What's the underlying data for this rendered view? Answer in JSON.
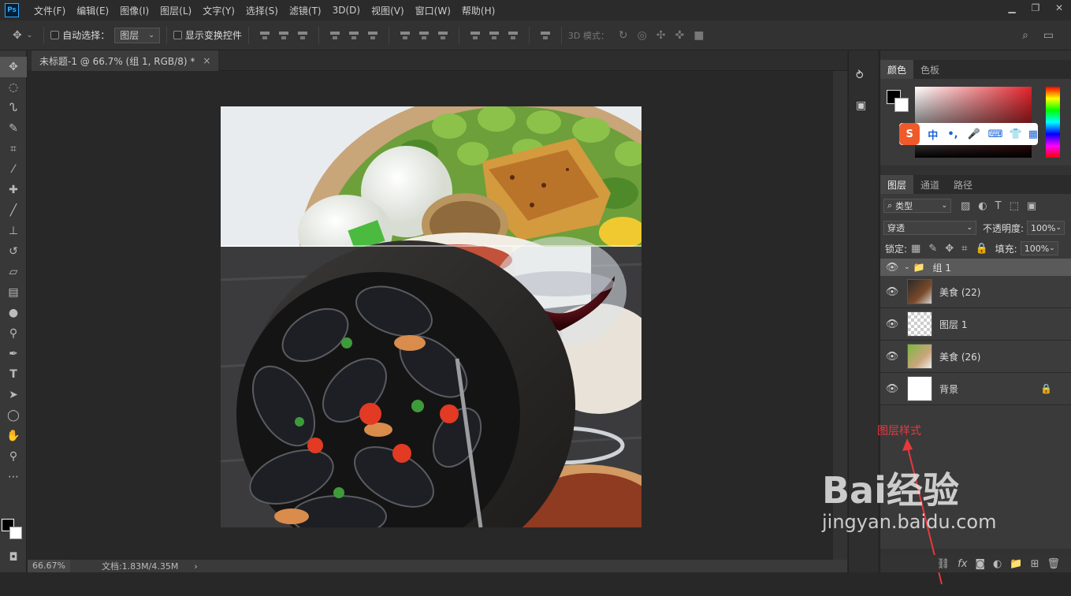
{
  "menu": [
    "文件(F)",
    "编辑(E)",
    "图像(I)",
    "图层(L)",
    "文字(Y)",
    "选择(S)",
    "滤镜(T)",
    "3D(D)",
    "视图(V)",
    "窗口(W)",
    "帮助(H)"
  ],
  "app_logo": "Ps",
  "options": {
    "auto_select_label": "自动选择：",
    "auto_select_value": "图层",
    "show_transform_label": "显示变换控件",
    "mode3d_label": "3D 模式："
  },
  "document": {
    "tab_title": "未标题-1 @ 66.7% (组 1, RGB/8) *",
    "close_glyph": "×"
  },
  "status": {
    "zoom": "66.67%",
    "doc_info": "文档:1.83M/4.35M"
  },
  "color_panel": {
    "tabs": [
      "颜色",
      "色板"
    ],
    "ime_labels": [
      "中",
      "•,"
    ]
  },
  "layers_panel": {
    "tabs": [
      "图层",
      "通道",
      "路径"
    ],
    "filter_label": "类型",
    "blend_mode": "穿透",
    "opacity_label": "不透明度:",
    "opacity_value": "100%",
    "lock_label": "锁定:",
    "fill_label": "填充:",
    "fill_value": "100%",
    "group_name": "组 1",
    "layers": [
      {
        "name": "美食 (22)"
      },
      {
        "name": "图层 1"
      },
      {
        "name": "美食 (26)"
      },
      {
        "name": "背景"
      }
    ]
  },
  "annotation": {
    "text": "图层样式",
    "color": "#e8383d"
  },
  "watermark": {
    "brand": "Bai经验",
    "url": "jingyan.baidu.com"
  }
}
